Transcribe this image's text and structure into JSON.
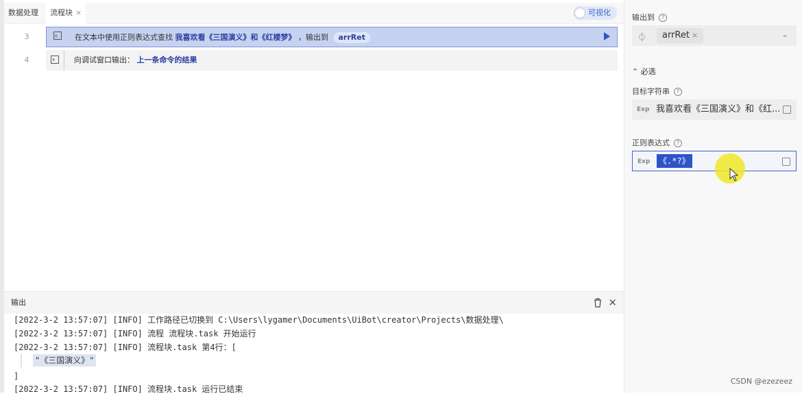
{
  "tabs": [
    {
      "label": "数据处理"
    },
    {
      "label": "流程块",
      "close": "×"
    }
  ],
  "toggle": {
    "label": "可视化"
  },
  "commands": [
    {
      "line": "3",
      "icon": "regex-icon",
      "prefix": "在文本中使用正则表达式查找",
      "target": "我喜欢看《三国演义》和《红楼梦》",
      "mid": "，输出到",
      "var": "arrRet"
    },
    {
      "line": "4",
      "icon": "terminal-icon",
      "prefix": "向调试窗口输出：",
      "target": "上一条命令的结果"
    }
  ],
  "output": {
    "title": "输出",
    "logs": [
      "[2022-3-2 13:57:07] [INFO] 工作路径已切换到 C:\\Users\\lygamer\\Documents\\UiBot\\creator\\Projects\\数据处理\\",
      "[2022-3-2 13:57:07] [INFO] 流程 流程块.task 开始运行",
      "[2022-3-2 13:57:07] [INFO] 流程块.task 第4行：[",
      "\"《三国演义》\"",
      "]",
      "[2022-3-2 13:57:07] [INFO] 流程块.task 运行已结束"
    ]
  },
  "properties": {
    "output_to_label": "输出到",
    "output_var": "arrRet",
    "required_label": "必选",
    "target_label": "目标字符串",
    "target_tag": "Exp",
    "target_value": "我喜欢看《三国演义》和《红...",
    "regex_label": "正则表达式",
    "regex_tag": "Exp",
    "regex_value": "《.*?》"
  },
  "watermark": "CSDN @ezezeez",
  "colors": {
    "accent": "#2f54c7",
    "selected_row": "#c6d2f0",
    "cursor_highlight": "#f0e628"
  }
}
